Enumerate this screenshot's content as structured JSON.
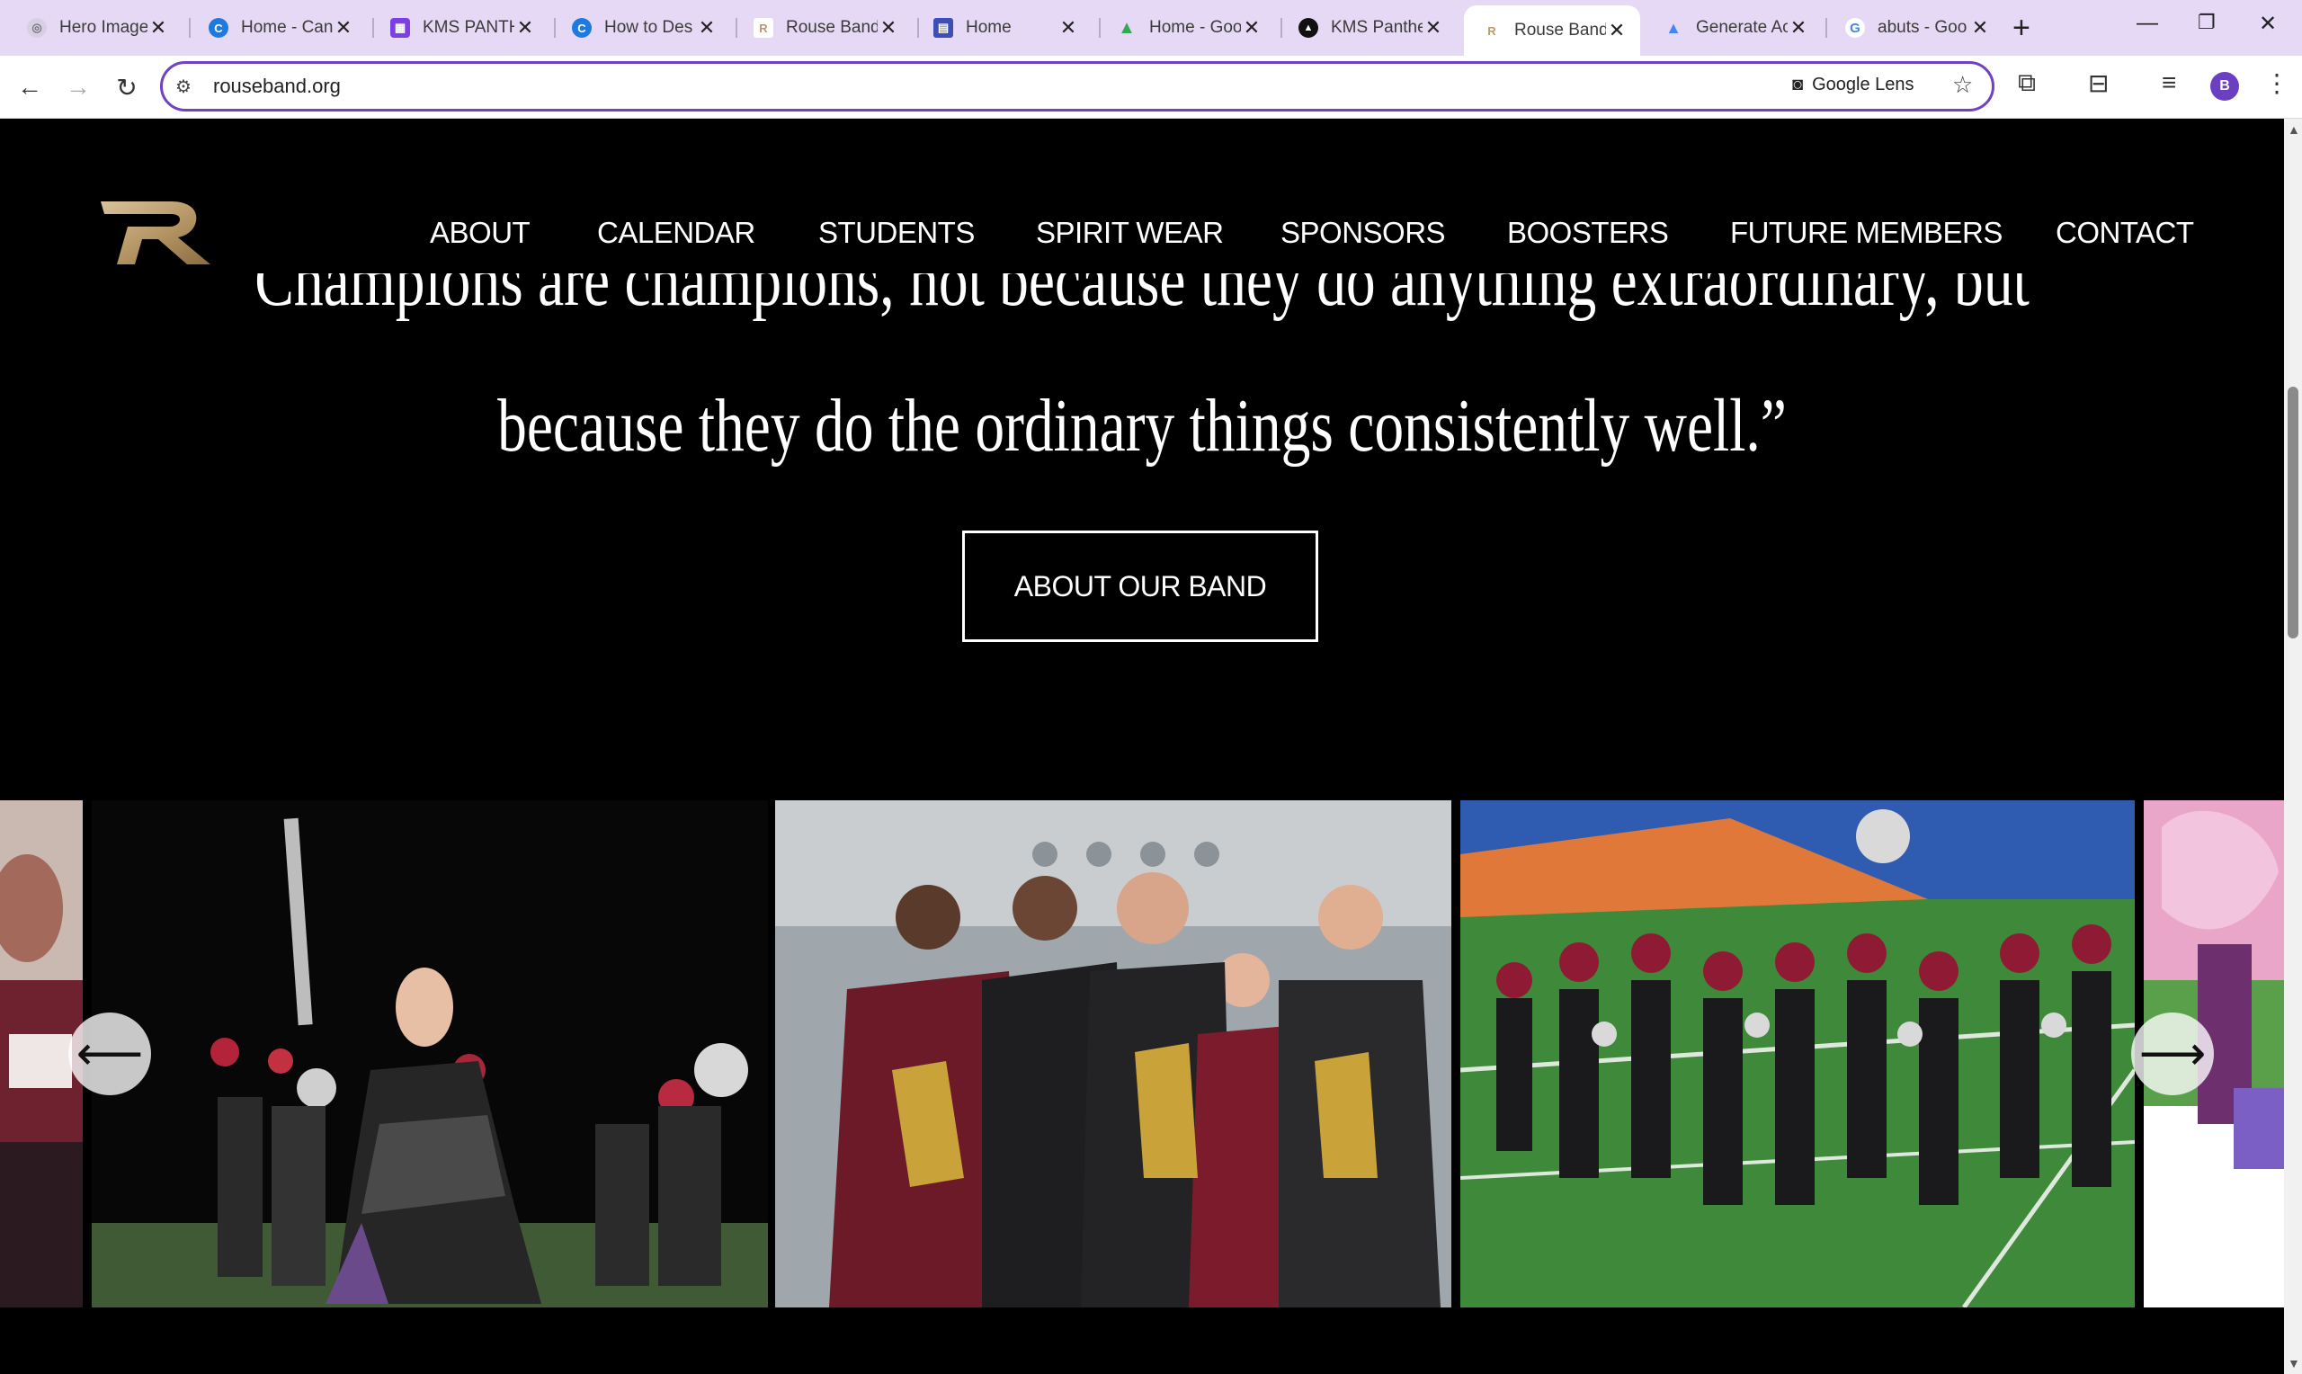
{
  "browser": {
    "tabs": [
      {
        "title": "Hero Image",
        "favicon": "openai-icon",
        "active": false
      },
      {
        "title": "Home - Can",
        "favicon": "canva-icon",
        "active": false
      },
      {
        "title": "KMS PANTH",
        "favicon": "calendar-app-icon",
        "active": false
      },
      {
        "title": "How to Des",
        "favicon": "canva-icon",
        "active": false
      },
      {
        "title": "Rouse Band",
        "favicon": "rouse-logo-icon",
        "active": false
      },
      {
        "title": "Home",
        "favicon": "forms-icon",
        "active": false
      },
      {
        "title": "Home - Goo",
        "favicon": "google-drive-icon",
        "active": false
      },
      {
        "title": "KMS Panthe",
        "favicon": "triangle-app-icon",
        "active": false
      },
      {
        "title": "Rouse Band",
        "favicon": "rouse-logo-icon",
        "active": true
      },
      {
        "title": "Generate Ac",
        "favicon": "google-ads-icon",
        "active": false
      },
      {
        "title": "abuts - Goo",
        "favicon": "google-icon",
        "active": false
      }
    ],
    "url": "rouseband.org",
    "lens_label": "Google Lens",
    "profile_initial": "B",
    "accent_color": "#6f42c1"
  },
  "site": {
    "nav": [
      "ABOUT",
      "CALENDAR",
      "STUDENTS",
      "SPIRIT WEAR",
      "SPONSORS",
      "BOOSTERS",
      "FUTURE MEMBERS",
      "CONTACT"
    ],
    "quote_line1": "Champions are champions, not because they do anything extraordinary, but",
    "quote_line2": "because they do the ordinary things consistently well.”",
    "cta_label": "ABOUT OUR BAND",
    "logo_color": "#b99a6b",
    "carousel": {
      "slides": [
        "color-guard-performer-with-rifle-photo",
        "band-members-group-photo",
        "marching-band-on-field-photo"
      ],
      "prev_icon": "arrow-left-icon",
      "next_icon": "arrow-right-icon"
    }
  }
}
